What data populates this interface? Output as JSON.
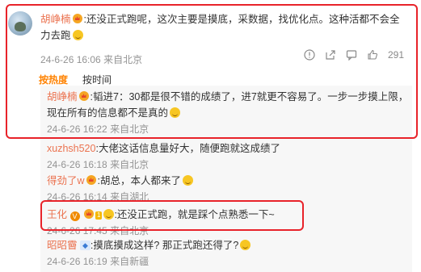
{
  "main_comment": {
    "username": "胡峥楠",
    "text": ":还没正式跑呢，这次主要是摸底，采数据，找优化点。这种活都不会全力去跑",
    "date": "24-6-26 16:06",
    "source": "来自北京",
    "like_count": "291"
  },
  "sort_tabs": {
    "hot": "按热度",
    "time": "按时间"
  },
  "replies": [
    {
      "username": "胡峥楠",
      "text": ":韬进7：30都是很不错的成绩了，进7就更不容易了。一步一步摸上限，现在所有的信息都不是真的",
      "date": "24-6-26 16:22",
      "source": "来自北京"
    },
    {
      "username": "xuzhsh520",
      "text": ":大佬这话信息量好大，随便跑就这成绩了",
      "date": "24-6-26 16:18",
      "source": "来自北京"
    },
    {
      "username": "得劲了w",
      "text": ":胡总，本人都来了",
      "date": "24-6-26 16:14",
      "source": "来自湖北"
    },
    {
      "username": "王化",
      "level": "1",
      "text": ":还没正式跑，就是踩个点熟悉一下~",
      "date": "24-6-26 17:45",
      "source": "来自北京"
    },
    {
      "username": "昭昭霫",
      "text": ":摸底摸成这样? 那正式跑还得了?",
      "date": "24-6-26 16:19",
      "source": "来自新疆"
    }
  ],
  "colors": {
    "highlight": "#e8232a",
    "username": "#eb7350",
    "active_tab": "#ff8200"
  }
}
